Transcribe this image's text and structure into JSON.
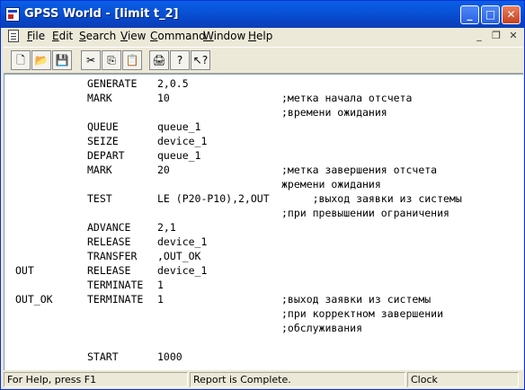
{
  "window": {
    "title": "GPSS World - [limit t_2]"
  },
  "title_buttons": {
    "minimize": "_",
    "maximize": "□",
    "close": "✕"
  },
  "menu": {
    "items": [
      {
        "first": "F",
        "rest": "ile"
      },
      {
        "first": "E",
        "rest": "dit"
      },
      {
        "first": "S",
        "rest": "earch"
      },
      {
        "first": "V",
        "rest": "iew"
      },
      {
        "first": "C",
        "rest": "ommand"
      },
      {
        "first": "W",
        "rest": "indow"
      },
      {
        "first": "H",
        "rest": "elp"
      }
    ],
    "mdi": {
      "minimize": "_",
      "restore": "❐",
      "close": "✕"
    }
  },
  "toolbar": {
    "icons": [
      "new-file-icon",
      "open-folder-icon",
      "save-disk-icon",
      "cut-icon",
      "copy-icon",
      "paste-icon",
      "print-icon",
      "help-icon",
      "context-help-icon"
    ],
    "glyphs": [
      "🗋",
      "📂",
      "💾",
      "✂",
      "⎘",
      "📋",
      "🖨",
      "?",
      "↖?"
    ]
  },
  "code": [
    {
      "label": "",
      "op": "GENERATE",
      "arg": "2,0.5",
      "comment": ""
    },
    {
      "label": "",
      "op": "MARK",
      "arg": "10",
      "comment": ";метка начала отсчета"
    },
    {
      "label": "",
      "op": "",
      "arg": "",
      "comment": ";времени ожидания"
    },
    {
      "label": "",
      "op": "QUEUE",
      "arg": "queue_1",
      "comment": ""
    },
    {
      "label": "",
      "op": "SEIZE",
      "arg": "device_1",
      "comment": ""
    },
    {
      "label": "",
      "op": "DEPART",
      "arg": "queue_1",
      "comment": ""
    },
    {
      "label": "",
      "op": "MARK",
      "arg": "20",
      "comment": ";метка завершения отсчета"
    },
    {
      "label": "",
      "op": "",
      "arg": "",
      "comment": "жремени ожидания"
    },
    {
      "label": "",
      "op": "TEST",
      "arg": "LE (P20-P10),2,OUT",
      "comment": "     ;выход заявки из системы"
    },
    {
      "label": "",
      "op": "",
      "arg": "",
      "comment": ";при превышении ограничения"
    },
    {
      "label": "",
      "op": "ADVANCE",
      "arg": "2,1",
      "comment": ""
    },
    {
      "label": "",
      "op": "RELEASE",
      "arg": "device_1",
      "comment": ""
    },
    {
      "label": "",
      "op": "TRANSFER",
      "arg": ",OUT_OK",
      "comment": ""
    },
    {
      "label": "OUT",
      "op": "RELEASE",
      "arg": "device_1",
      "comment": ""
    },
    {
      "label": "",
      "op": "TERMINATE",
      "arg": "1",
      "comment": ""
    },
    {
      "label": "OUT_OK",
      "op": "TERMINATE",
      "arg": "1",
      "comment": ";выход заявки из системы"
    },
    {
      "label": "",
      "op": "",
      "arg": "",
      "comment": ";при корректном завершении"
    },
    {
      "label": "",
      "op": "",
      "arg": "",
      "comment": ";обслуживания"
    },
    {
      "label": "",
      "op": "",
      "arg": "",
      "comment": ""
    },
    {
      "label": "",
      "op": "START",
      "arg": "1000",
      "comment": ""
    }
  ],
  "status": {
    "help": "For Help, press F1",
    "report": "Report is Complete.",
    "clock": "Clock"
  }
}
